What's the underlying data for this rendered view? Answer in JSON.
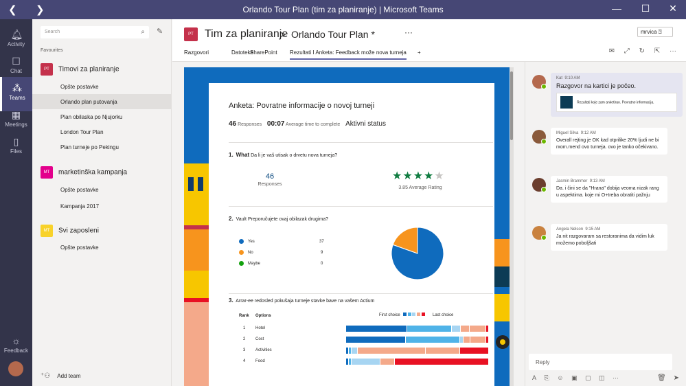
{
  "window": {
    "title": "Orlando Tour Plan (tim za planiranje) | Microsoft Teams",
    "back": "❮",
    "forward": "❯",
    "min": "—",
    "max": "☐",
    "close": "✕"
  },
  "rail": [
    {
      "label": "Activity",
      "icon": "bell-icon",
      "glyph": "🔔︎"
    },
    {
      "label": "Chat",
      "icon": "chat-icon",
      "glyph": "☐"
    },
    {
      "label": "Teams",
      "icon": "teams-icon",
      "glyph": "⁂"
    },
    {
      "label": "Meetings",
      "icon": "calendar-icon",
      "glyph": "▦"
    },
    {
      "label": "Files",
      "icon": "file-icon",
      "glyph": "▯"
    }
  ],
  "rail_bottom": {
    "feedback": "Feedback"
  },
  "sidebar": {
    "search_placeholder": "Search",
    "favourites": "Favourites",
    "teams": [
      {
        "badge": "PT",
        "badge_color": "#c4314b",
        "name": "Timovi za planiranje",
        "channels": [
          "Opšte postavke",
          "Orlando plan putovanja",
          "Plan obilaska po Njujorku",
          "London Tour Plan",
          "Plan turneje po Pekingu"
        ]
      },
      {
        "badge": "MT",
        "badge_color": "#e3008c",
        "name": "marketinška kampanja",
        "channels": [
          "Opšte postavke",
          "Kampanja 2017"
        ]
      },
      {
        "badge": "MT",
        "badge_color": "#f8d22a",
        "name": "Svi zaposleni",
        "channels": [
          "Opšte postavke"
        ]
      }
    ],
    "add_team": "Add team"
  },
  "header": {
    "badge": "PT",
    "team": "Tim za planiranje",
    "separator": ">",
    "channel": "Orlando Tour Plan *",
    "more": "···",
    "user": "mrvica",
    "tabs": [
      "Razgovori",
      "Datoteke",
      "SharePoint",
      "Rezultati I Anketa: Feedback može nova turneja"
    ],
    "add_tab": "+"
  },
  "survey": {
    "title": "Anketa: Povratne informacije o novoj turneji",
    "responses_count": "46",
    "responses_label": "Responses",
    "avg_time": "00:07",
    "avg_time_label": "Average time to complete",
    "status": "Aktivni status",
    "q1": {
      "num": "1.",
      "prefix": "What",
      "text": "Da li je vaš utisak o drvetu nova turneja?",
      "responses": "46",
      "responses_label": "Responses",
      "rating_label": "3.85 Average Rating",
      "rating": 3.85
    },
    "q2": {
      "num": "2.",
      "text": "Vault Preporučujete ovaj obilazak drugima?",
      "options": [
        {
          "label": "Yes",
          "value": 37,
          "color": "#0f6bbd"
        },
        {
          "label": "No",
          "value": 9,
          "color": "#f7941d"
        },
        {
          "label": "Maybe",
          "value": 0,
          "color": "#13a10e"
        }
      ]
    },
    "q3": {
      "num": "3.",
      "text": "Arrar-ee redosled pokušaja turneje stavke bave na vašem Actium",
      "col_rank": "Rank",
      "col_options": "Options",
      "first_choice": "First choice",
      "last_choice": "Last choice",
      "rows": [
        {
          "rank": "1",
          "option": "Hotel",
          "segments": [
            0.41,
            0.3,
            0.06,
            0.06,
            0.11,
            0.02
          ]
        },
        {
          "rank": "2",
          "option": "Cost",
          "segments": [
            0.42,
            0.38,
            0.02,
            0.05,
            0.11,
            0.02
          ]
        },
        {
          "rank": "3",
          "option": "Activities",
          "segments": [
            0.02,
            0.02,
            0.04,
            0.48,
            0.24,
            0.2
          ]
        },
        {
          "rank": "4",
          "option": "Food",
          "segments": [
            0.02,
            0.02,
            0.2,
            0.0,
            0.1,
            0.66
          ]
        }
      ],
      "segment_colors": [
        "#0f6bbd",
        "#4fb3e8",
        "#a7d5f2",
        "#f4a98a",
        "#f4a98a",
        "#e81123"
      ]
    }
  },
  "conversation": [
    {
      "author": "Kat",
      "time": "9:10 AM",
      "text": "Razgovor na kartici je počeo.",
      "card": "Rezultati koje zam anketirao. Povratne informacija.",
      "mine": true
    },
    {
      "author": "Miguel Silva",
      "time": "9:12 AM",
      "text": "Overall rejting je OK kad otprilike 20% ljudi ne bi rxom.mend ovo turneja. ovo je tanko očekivano."
    },
    {
      "author": "Jasmin Brammer",
      "time": "9:13 AM",
      "text": "Da. i čini se da \"Hrana\" dobija veoma nizak rang u aspektima. koje mi O+treba obratiti pažnju"
    },
    {
      "author": "Angela Nelson",
      "time": "9:15 AM",
      "text": "Ja nit razgovaram sa restoranima da vidim luk možemo poboljšati"
    }
  ],
  "reply_placeholder": "Reply"
}
